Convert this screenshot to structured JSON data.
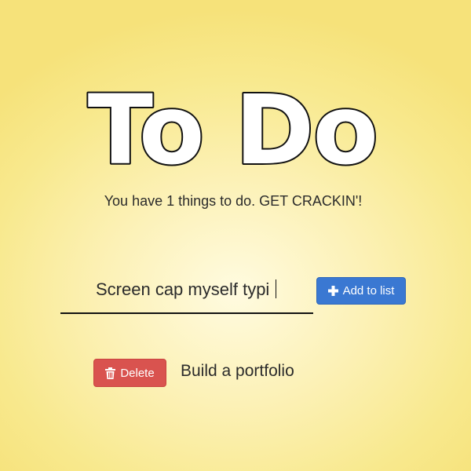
{
  "header": {
    "title": "To Do",
    "subtitle": "You have 1 things to do. GET CRACKIN'!"
  },
  "new_task": {
    "value": "Screen cap myself typi",
    "add_button_label": "Add to list",
    "add_icon": "plus-icon"
  },
  "todo_items": [
    {
      "text": "Build a portfolio",
      "delete_label": "Delete",
      "delete_icon": "trash-icon"
    }
  ],
  "colors": {
    "add_button": "#3a78d2",
    "delete_button": "#d9534f",
    "background": "#f8e98e"
  }
}
